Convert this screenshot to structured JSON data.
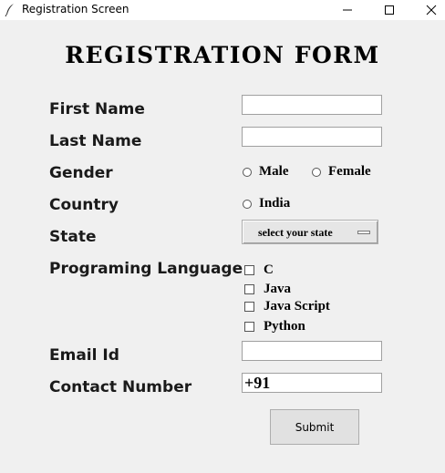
{
  "window": {
    "title": "Registration Screen",
    "icons": [
      "feather-icon",
      "minimize-icon",
      "maximize-icon",
      "close-icon"
    ]
  },
  "form": {
    "title": "REGISTRATION FORM",
    "labels": {
      "first_name": "First Name",
      "last_name": "Last Name",
      "gender": "Gender",
      "country": "Country",
      "state": "State",
      "language": "Programing Language",
      "email": "Email Id",
      "contact": "Contact Number"
    },
    "fields": {
      "first_name": "",
      "last_name": "",
      "email": "",
      "contact": "+91"
    },
    "gender_options": [
      "Male",
      "Female"
    ],
    "country_options": [
      "India"
    ],
    "state_menu": "select your state",
    "languages": [
      "C",
      "Java",
      "Java Script",
      "Python"
    ],
    "submit": "Submit"
  }
}
